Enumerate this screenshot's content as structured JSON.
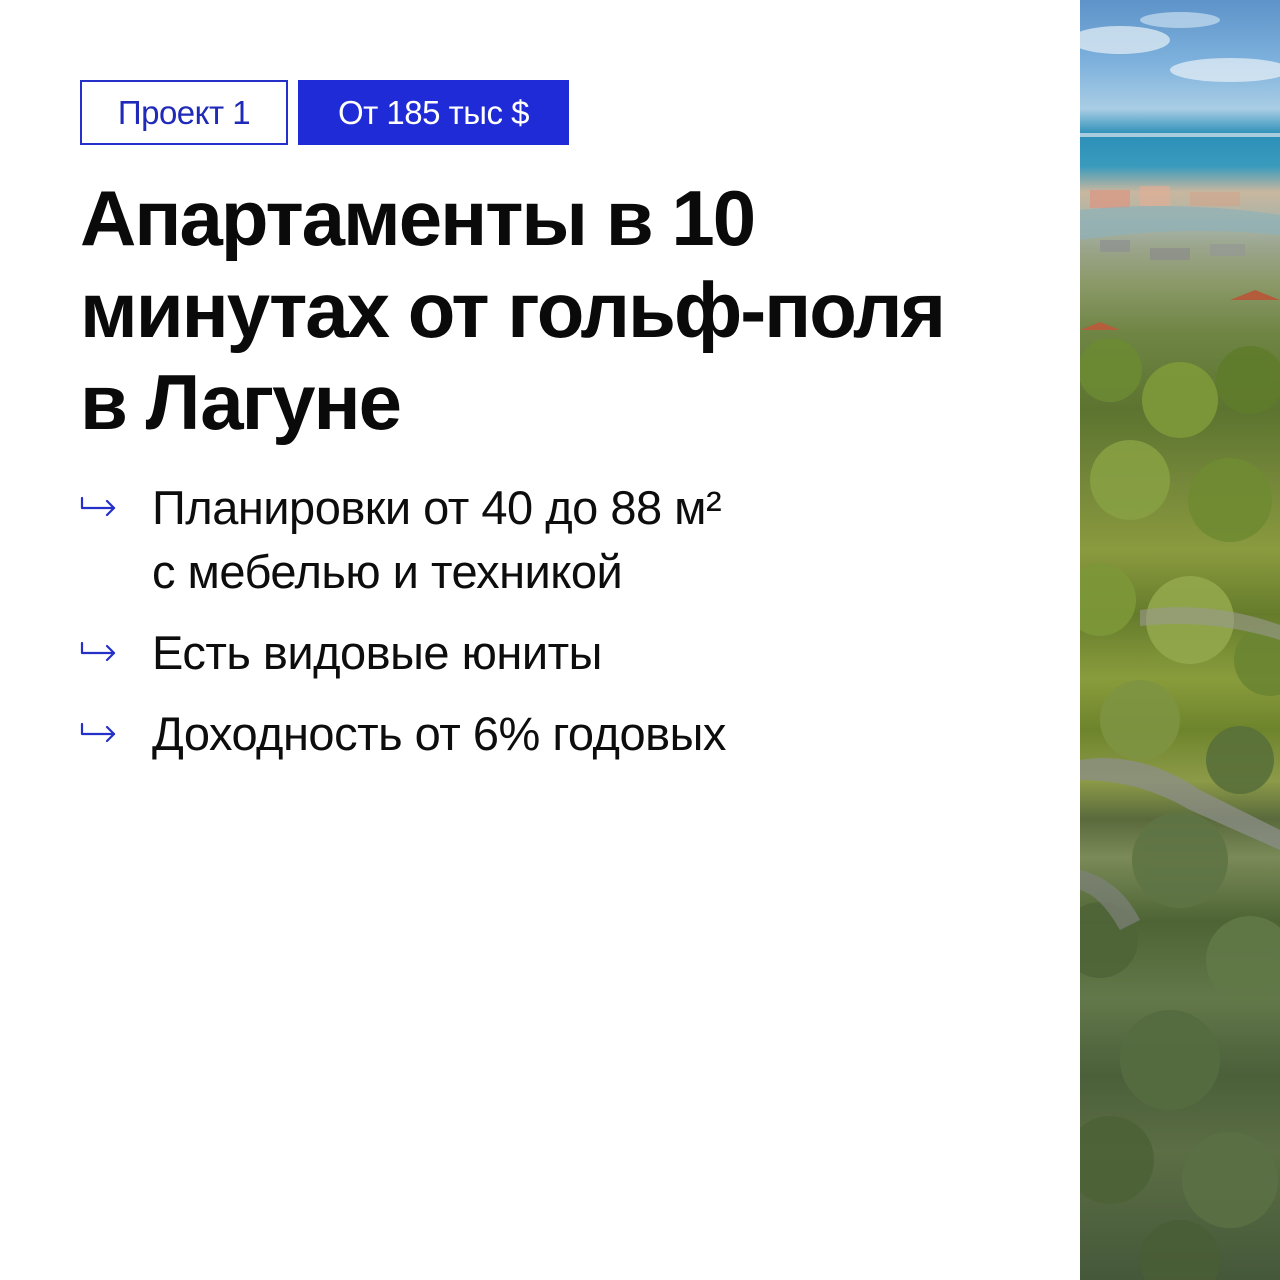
{
  "tags": {
    "project": "Проект 1",
    "price": "От 185 тыс $"
  },
  "title": {
    "lines": [
      "Апартаменты в 10",
      "минутах от гольф-поля",
      "в Лагуне"
    ]
  },
  "bullets": [
    {
      "lines": [
        "Планировки от 40 до 88 м²",
        "с мебелью и техникой"
      ]
    },
    {
      "lines": [
        "Есть видовые юниты"
      ]
    },
    {
      "lines": [
        "Доходность от 6% годовых"
      ]
    }
  ],
  "icons": {
    "bullet": "arrow-right-hook-icon"
  },
  "colors": {
    "accent": "#1f2bd6",
    "text": "#0a0a0a",
    "background": "#ffffff"
  }
}
